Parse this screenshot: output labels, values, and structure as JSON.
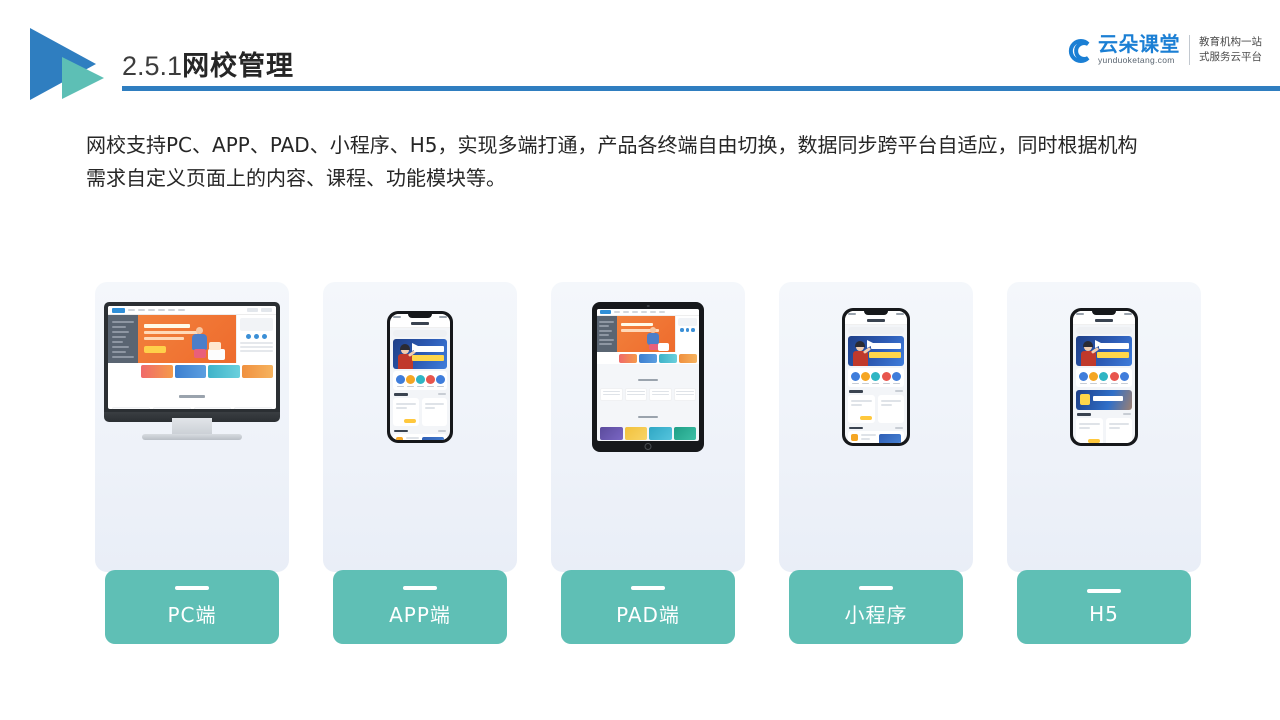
{
  "header": {
    "section_number": "2.5.1",
    "section_title": "网校管理",
    "logo_icon": "double-triangle-play-icon",
    "rule_color": "#2f7ec0"
  },
  "brand": {
    "icon": "cloud-icon",
    "name_cn": "云朵课堂",
    "domain": "yunduoketang.com",
    "tagline_line1": "教育机构一站",
    "tagline_line2": "式服务云平台",
    "color": "#1b7fd4"
  },
  "body": {
    "paragraph_line1": "网校支持PC、APP、PAD、小程序、H5，实现多端打通，产品各终端自由切换，数据同步跨平台自适应，同时根据机构",
    "paragraph_line2": "需求自定义页面上的内容、课程、功能模块等。"
  },
  "cards": [
    {
      "label": "PC端",
      "device": "desktop-monitor-mockup"
    },
    {
      "label": "APP端",
      "device": "smartphone-mockup"
    },
    {
      "label": "PAD端",
      "device": "tablet-mockup"
    },
    {
      "label": "小程序",
      "device": "smartphone-mockup"
    },
    {
      "label": "H5",
      "device": "smartphone-mockup"
    }
  ],
  "theme": {
    "pill_color": "#5fbfb5",
    "card_bg": "#f1f5fb",
    "accent_blue": "#2f7ec0",
    "accent_teal": "#5dbfb5",
    "text_color": "#262626"
  }
}
